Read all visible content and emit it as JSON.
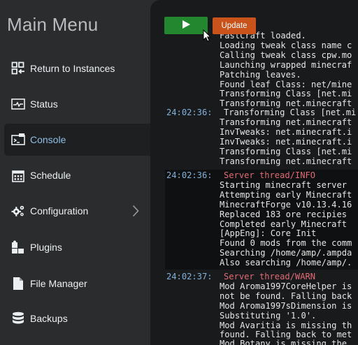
{
  "sidebar": {
    "title": "Main Menu",
    "items": [
      {
        "label": "Return to Instances",
        "icon": "instances-grid-icon"
      },
      {
        "label": "Status",
        "icon": "pulse-monitor-icon"
      },
      {
        "label": "Console",
        "icon": "console-terminal-icon",
        "active": true
      },
      {
        "label": "Schedule",
        "icon": "calendar-icon"
      },
      {
        "label": "Configuration",
        "icon": "gears-icon"
      },
      {
        "label": "Plugins",
        "icon": "puzzle-plugin-icon"
      },
      {
        "label": "File Manager",
        "icon": "file-icon"
      },
      {
        "label": "Backups",
        "icon": "database-stack-icon"
      }
    ]
  },
  "toolbar": {
    "play_icon": "play-icon",
    "update_label": "Update"
  },
  "console": {
    "block1_lines": [
      "FastCraft loaded.",
      "Loading tweak class name c",
      "Calling tweak class cpw.mo",
      "Launching wrapped minecraf",
      "Patching leaves.",
      "Found leaf Class: net/mine",
      "Transforming Class [net.mi",
      "Transforming net.minecraft"
    ],
    "block2_timestamp": "24:02:36:",
    "block2_first": "Transforming Class [net.mi",
    "block2_lines": [
      "Transforming net.minecraft",
      "InvTweaks: net.minecraft.i",
      "InvTweaks: net.minecraft.i",
      "Transforming Class [net.mi",
      "Transforming net.minecraft"
    ],
    "block3_timestamp": "24:02:36:",
    "block3_source": "Server thread/INFO",
    "block3_lines": [
      "Starting minecraft server",
      "Attempting early Minecraft",
      "MinecraftForge v10.13.4.16",
      "Replaced 183 ore recipies",
      "Completed early Minecraft",
      "[AppEng]: Core Init",
      "Found 0 mods from the comm",
      "Searching /home/amp/.ampda",
      "Also searching /home/amp/."
    ],
    "block4_timestamp": "24:02:37:",
    "block4_source": "Server thread/WARN",
    "block4_lines": [
      "Mod Aroma1997CoreHelper is",
      "not be found. Falling back",
      "Mod Aroma1997sDimension is",
      "Substituting '1.0'.",
      "Mod Avaritia is missing th",
      "found. Falling back to met",
      "Mod Botany is missing the"
    ]
  },
  "colors": {
    "sidebar_bg": "#2b2c2e",
    "console_bg": "#191a1c",
    "timestamp": "#7fb2dd",
    "source_label": "#e06b74",
    "play_button": "#23872f",
    "update_button": "#c9531a"
  }
}
